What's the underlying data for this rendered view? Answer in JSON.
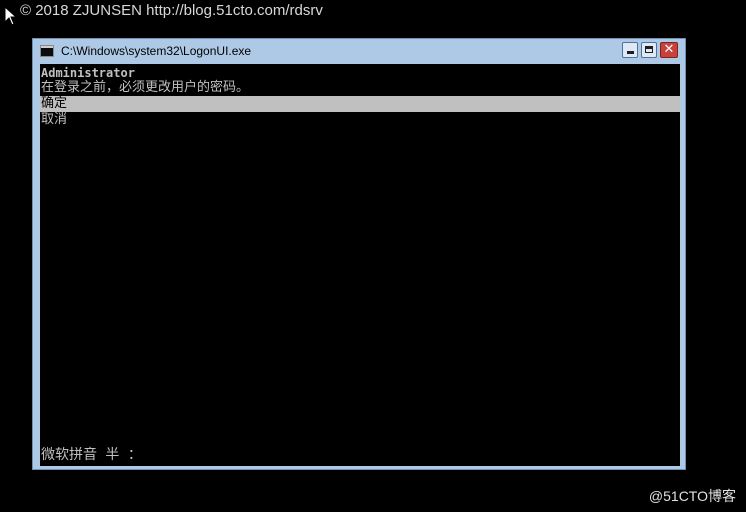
{
  "watermark": {
    "top_text": "© 2018 ZJUNSEN http://blog.51cto.com/rdsrv",
    "bottom_text": "@51CTO博客"
  },
  "window": {
    "title": "C:\\Windows\\system32\\LogonUI.exe",
    "title_icon": "console-window-icon",
    "buttons": {
      "minimize_icon": "minimize-icon",
      "maximize_icon": "maximize-icon",
      "close_icon": "close-icon",
      "close_glyph": "✕"
    },
    "colors": {
      "frame": "#aec9e6",
      "close": "#c8413a",
      "console_bg": "#000000",
      "console_text": "#c0c0c0",
      "highlight": "#c0c0c0"
    }
  },
  "console": {
    "username": "Administrator",
    "message": "在登录之前，必须更改用户的密码。",
    "options": [
      {
        "label": "确定",
        "selected": true
      },
      {
        "label": "取消",
        "selected": false
      }
    ],
    "ime_status": "微软拼音 半 ："
  }
}
